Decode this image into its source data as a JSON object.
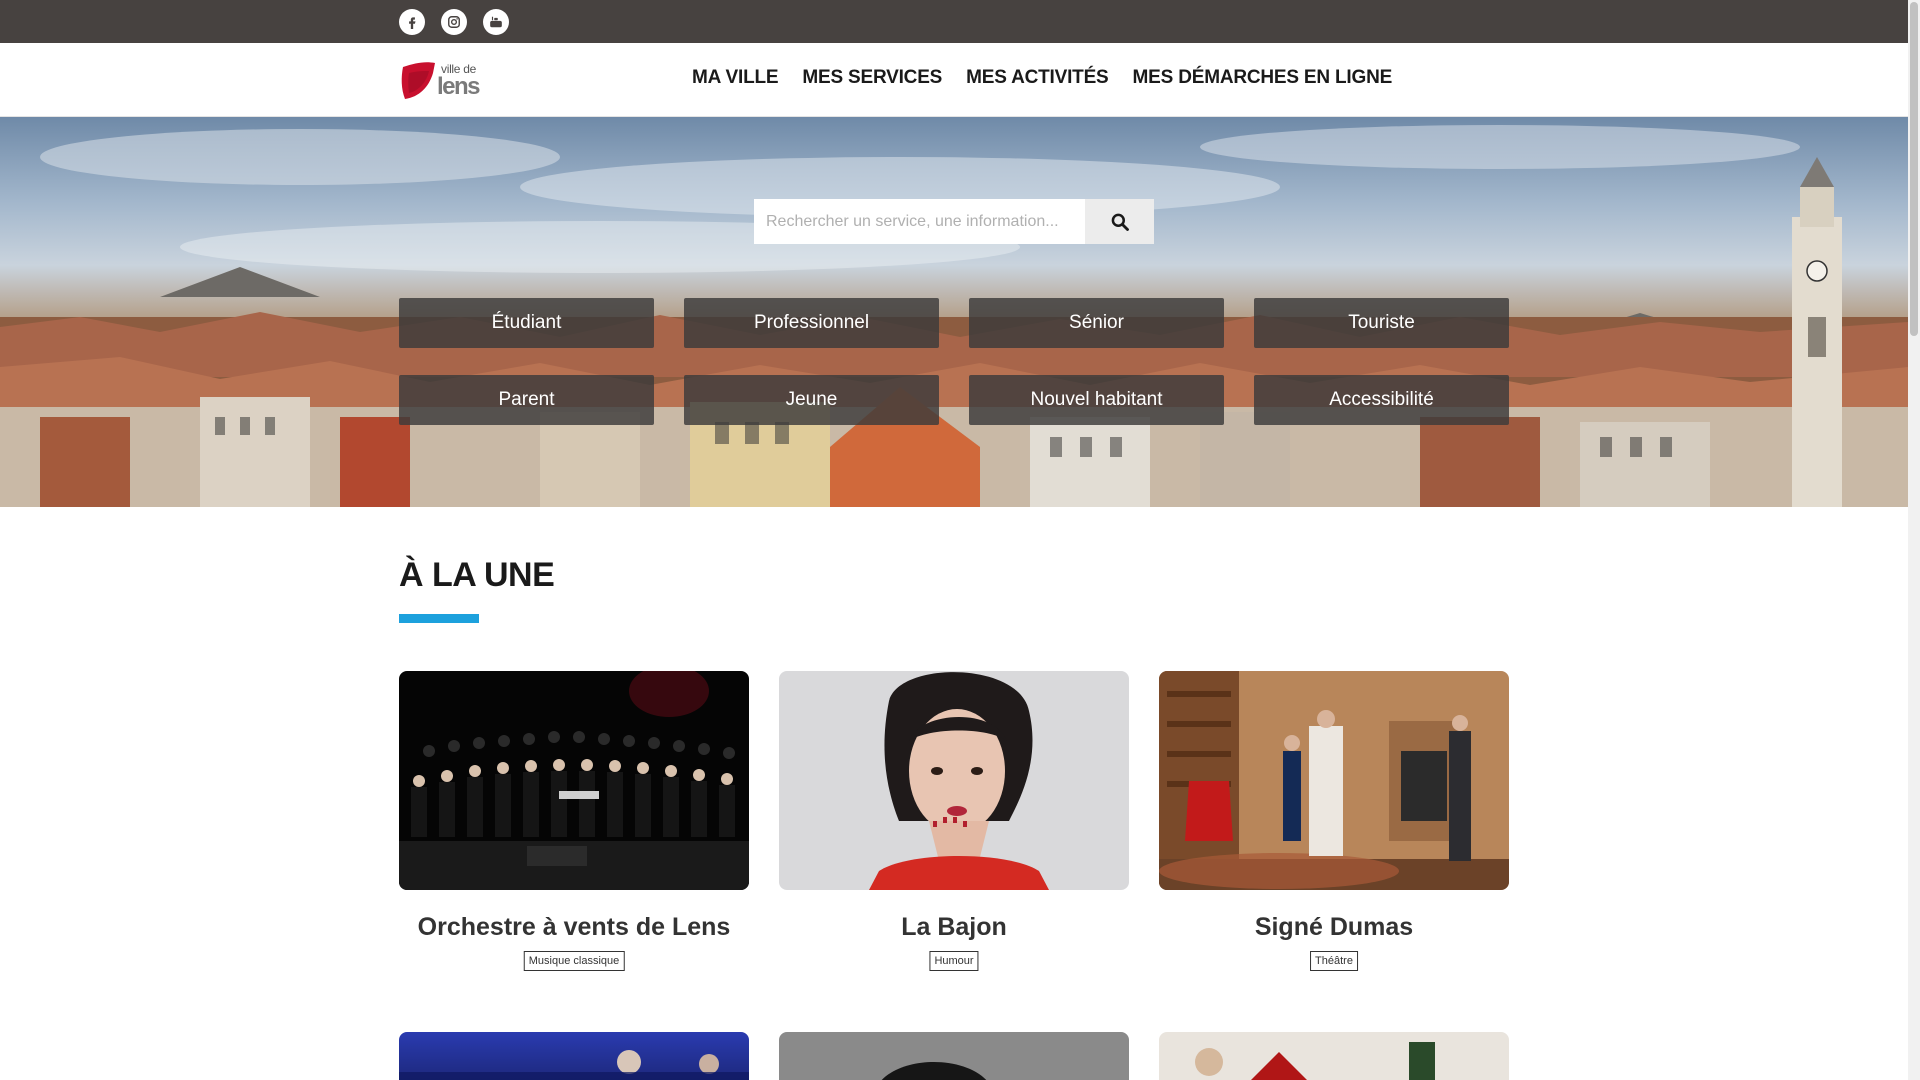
{
  "social": {
    "facebook": "facebook-icon",
    "instagram": "instagram-icon",
    "youtube": "youtube-icon"
  },
  "logo": {
    "line1": "ville de",
    "line2": "lens"
  },
  "nav": {
    "items": [
      {
        "label": "MA VILLE"
      },
      {
        "label": "MES SERVICES"
      },
      {
        "label": "MES ACTIVITÉS"
      },
      {
        "label": "MES DÉMARCHES EN LIGNE"
      }
    ]
  },
  "search": {
    "placeholder": "Rechercher un service, une information..."
  },
  "profiles": [
    {
      "label": "Étudiant"
    },
    {
      "label": "Professionnel"
    },
    {
      "label": "Sénior"
    },
    {
      "label": "Touriste"
    },
    {
      "label": "Parent"
    },
    {
      "label": "Jeune"
    },
    {
      "label": "Nouvel habitant"
    },
    {
      "label": "Accessibilité"
    }
  ],
  "section": {
    "title": "À LA UNE"
  },
  "cards": [
    {
      "title": "Orchestre à vents de Lens",
      "tag": "Musique classique"
    },
    {
      "title": "La Bajon",
      "tag": "Humour"
    },
    {
      "title": "Signé Dumas",
      "tag": "Théâtre"
    }
  ],
  "colors": {
    "topbar": "#474240",
    "accent": "#1da1dd",
    "logo_red": "#c8102e"
  }
}
